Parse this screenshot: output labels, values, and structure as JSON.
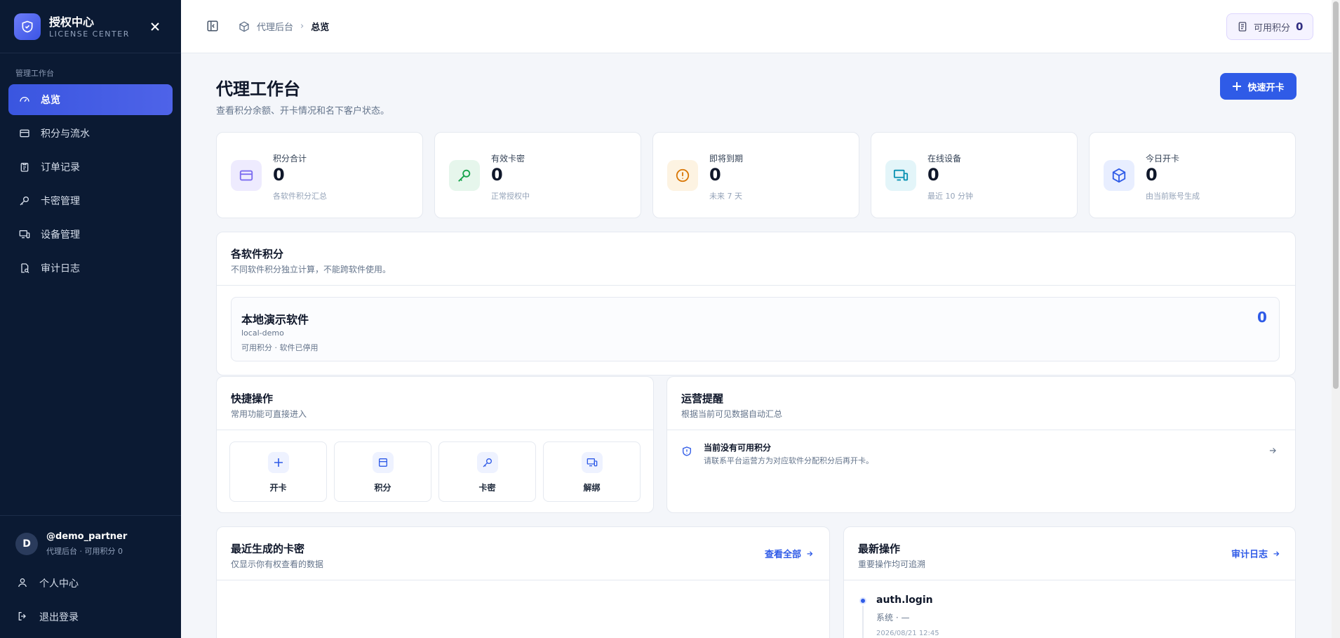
{
  "brand": {
    "title": "授权中心",
    "subtitle": "LICENSE CENTER"
  },
  "sidebar": {
    "section_label": "管理工作台",
    "items": [
      {
        "label": "总览",
        "icon": "gauge-icon",
        "active": true
      },
      {
        "label": "积分与流水",
        "icon": "card-icon"
      },
      {
        "label": "订单记录",
        "icon": "clipboard-icon"
      },
      {
        "label": "卡密管理",
        "icon": "key-icon"
      },
      {
        "label": "设备管理",
        "icon": "devices-icon"
      },
      {
        "label": "审计日志",
        "icon": "audit-icon"
      }
    ],
    "user": {
      "initial": "D",
      "name": "@demo_partner",
      "meta": "代理后台 · 可用积分 0"
    },
    "profile_label": "个人中心",
    "logout_label": "退出登录"
  },
  "topbar": {
    "breadcrumb": {
      "root": "代理后台",
      "current": "总览"
    },
    "points_label": "可用积分",
    "points_value": "0"
  },
  "page": {
    "title": "代理工作台",
    "subtitle": "查看积分余额、开卡情况和名下客户状态。",
    "quick_open_label": "快速开卡"
  },
  "stats": [
    {
      "label": "积分合计",
      "value": "0",
      "hint": "各软件积分汇总",
      "color": "#7c6cf0"
    },
    {
      "label": "有效卡密",
      "value": "0",
      "hint": "正常授权中",
      "color": "#16a34a"
    },
    {
      "label": "即将到期",
      "value": "0",
      "hint": "未来 7 天",
      "color": "#d97706"
    },
    {
      "label": "在线设备",
      "value": "0",
      "hint": "最近 10 分钟",
      "color": "#0891b2"
    },
    {
      "label": "今日开卡",
      "value": "0",
      "hint": "由当前账号生成",
      "color": "#2f5be7"
    }
  ],
  "software_points": {
    "title": "各软件积分",
    "subtitle": "不同软件积分独立计算，不能跨软件使用。",
    "item": {
      "name": "本地演示软件",
      "code": "local-demo",
      "meta": "可用积分 · 软件已停用",
      "value": "0"
    }
  },
  "quick_actions": {
    "title": "快捷操作",
    "subtitle": "常用功能可直接进入",
    "items": [
      {
        "label": "开卡",
        "icon": "plus-icon"
      },
      {
        "label": "积分",
        "icon": "wallet-icon"
      },
      {
        "label": "卡密",
        "icon": "key-icon"
      },
      {
        "label": "解绑",
        "icon": "unbind-device-icon"
      }
    ]
  },
  "ops_alerts": {
    "title": "运营提醒",
    "subtitle": "根据当前可见数据自动汇总",
    "item": {
      "title": "当前没有可用积分",
      "desc": "请联系平台运营方为对应软件分配积分后再开卡。"
    }
  },
  "recent_keys": {
    "title": "最近生成的卡密",
    "subtitle": "仅显示你有权查看的数据",
    "link": "查看全部"
  },
  "latest_ops": {
    "title": "最新操作",
    "subtitle": "重要操作均可追溯",
    "link": "审计日志",
    "entry": {
      "action": "auth.login",
      "meta": "系统 · —",
      "time": "2026/08/21 12:45"
    }
  }
}
